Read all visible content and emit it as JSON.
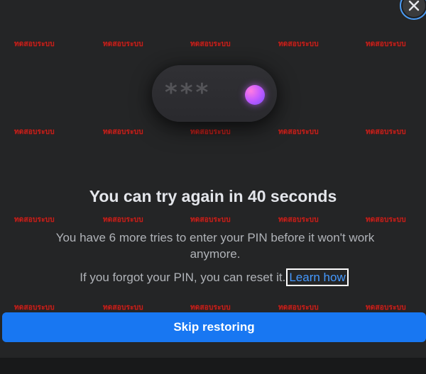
{
  "dialog": {
    "close_icon": "close-icon",
    "title": "You can try again in 40 seconds",
    "description": "You have 6 more tries to enter your PIN before it won't work anymore.",
    "forgot_text": "If you forgot your PIN, you can reset it.",
    "learn_link": "Learn how",
    "skip_button": "Skip restoring",
    "pin_mask": "***",
    "accent": "#1877f2"
  },
  "watermark": {
    "text": "ทดสอบระบบ",
    "color": "#c0221d"
  }
}
